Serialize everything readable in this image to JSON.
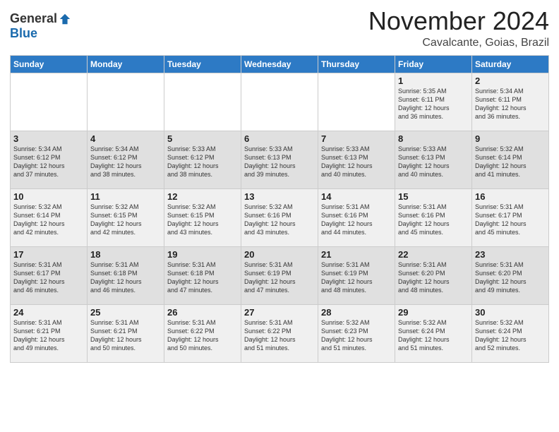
{
  "header": {
    "logo_general": "General",
    "logo_blue": "Blue",
    "month_title": "November 2024",
    "subtitle": "Cavalcante, Goias, Brazil"
  },
  "weekdays": [
    "Sunday",
    "Monday",
    "Tuesday",
    "Wednesday",
    "Thursday",
    "Friday",
    "Saturday"
  ],
  "rows": [
    [
      {
        "day": "",
        "text": ""
      },
      {
        "day": "",
        "text": ""
      },
      {
        "day": "",
        "text": ""
      },
      {
        "day": "",
        "text": ""
      },
      {
        "day": "",
        "text": ""
      },
      {
        "day": "1",
        "text": "Sunrise: 5:35 AM\nSunset: 6:11 PM\nDaylight: 12 hours\nand 36 minutes."
      },
      {
        "day": "2",
        "text": "Sunrise: 5:34 AM\nSunset: 6:11 PM\nDaylight: 12 hours\nand 36 minutes."
      }
    ],
    [
      {
        "day": "3",
        "text": "Sunrise: 5:34 AM\nSunset: 6:12 PM\nDaylight: 12 hours\nand 37 minutes."
      },
      {
        "day": "4",
        "text": "Sunrise: 5:34 AM\nSunset: 6:12 PM\nDaylight: 12 hours\nand 38 minutes."
      },
      {
        "day": "5",
        "text": "Sunrise: 5:33 AM\nSunset: 6:12 PM\nDaylight: 12 hours\nand 38 minutes."
      },
      {
        "day": "6",
        "text": "Sunrise: 5:33 AM\nSunset: 6:13 PM\nDaylight: 12 hours\nand 39 minutes."
      },
      {
        "day": "7",
        "text": "Sunrise: 5:33 AM\nSunset: 6:13 PM\nDaylight: 12 hours\nand 40 minutes."
      },
      {
        "day": "8",
        "text": "Sunrise: 5:33 AM\nSunset: 6:13 PM\nDaylight: 12 hours\nand 40 minutes."
      },
      {
        "day": "9",
        "text": "Sunrise: 5:32 AM\nSunset: 6:14 PM\nDaylight: 12 hours\nand 41 minutes."
      }
    ],
    [
      {
        "day": "10",
        "text": "Sunrise: 5:32 AM\nSunset: 6:14 PM\nDaylight: 12 hours\nand 42 minutes."
      },
      {
        "day": "11",
        "text": "Sunrise: 5:32 AM\nSunset: 6:15 PM\nDaylight: 12 hours\nand 42 minutes."
      },
      {
        "day": "12",
        "text": "Sunrise: 5:32 AM\nSunset: 6:15 PM\nDaylight: 12 hours\nand 43 minutes."
      },
      {
        "day": "13",
        "text": "Sunrise: 5:32 AM\nSunset: 6:16 PM\nDaylight: 12 hours\nand 43 minutes."
      },
      {
        "day": "14",
        "text": "Sunrise: 5:31 AM\nSunset: 6:16 PM\nDaylight: 12 hours\nand 44 minutes."
      },
      {
        "day": "15",
        "text": "Sunrise: 5:31 AM\nSunset: 6:16 PM\nDaylight: 12 hours\nand 45 minutes."
      },
      {
        "day": "16",
        "text": "Sunrise: 5:31 AM\nSunset: 6:17 PM\nDaylight: 12 hours\nand 45 minutes."
      }
    ],
    [
      {
        "day": "17",
        "text": "Sunrise: 5:31 AM\nSunset: 6:17 PM\nDaylight: 12 hours\nand 46 minutes."
      },
      {
        "day": "18",
        "text": "Sunrise: 5:31 AM\nSunset: 6:18 PM\nDaylight: 12 hours\nand 46 minutes."
      },
      {
        "day": "19",
        "text": "Sunrise: 5:31 AM\nSunset: 6:18 PM\nDaylight: 12 hours\nand 47 minutes."
      },
      {
        "day": "20",
        "text": "Sunrise: 5:31 AM\nSunset: 6:19 PM\nDaylight: 12 hours\nand 47 minutes."
      },
      {
        "day": "21",
        "text": "Sunrise: 5:31 AM\nSunset: 6:19 PM\nDaylight: 12 hours\nand 48 minutes."
      },
      {
        "day": "22",
        "text": "Sunrise: 5:31 AM\nSunset: 6:20 PM\nDaylight: 12 hours\nand 48 minutes."
      },
      {
        "day": "23",
        "text": "Sunrise: 5:31 AM\nSunset: 6:20 PM\nDaylight: 12 hours\nand 49 minutes."
      }
    ],
    [
      {
        "day": "24",
        "text": "Sunrise: 5:31 AM\nSunset: 6:21 PM\nDaylight: 12 hours\nand 49 minutes."
      },
      {
        "day": "25",
        "text": "Sunrise: 5:31 AM\nSunset: 6:21 PM\nDaylight: 12 hours\nand 50 minutes."
      },
      {
        "day": "26",
        "text": "Sunrise: 5:31 AM\nSunset: 6:22 PM\nDaylight: 12 hours\nand 50 minutes."
      },
      {
        "day": "27",
        "text": "Sunrise: 5:31 AM\nSunset: 6:22 PM\nDaylight: 12 hours\nand 51 minutes."
      },
      {
        "day": "28",
        "text": "Sunrise: 5:32 AM\nSunset: 6:23 PM\nDaylight: 12 hours\nand 51 minutes."
      },
      {
        "day": "29",
        "text": "Sunrise: 5:32 AM\nSunset: 6:24 PM\nDaylight: 12 hours\nand 51 minutes."
      },
      {
        "day": "30",
        "text": "Sunrise: 5:32 AM\nSunset: 6:24 PM\nDaylight: 12 hours\nand 52 minutes."
      }
    ]
  ]
}
